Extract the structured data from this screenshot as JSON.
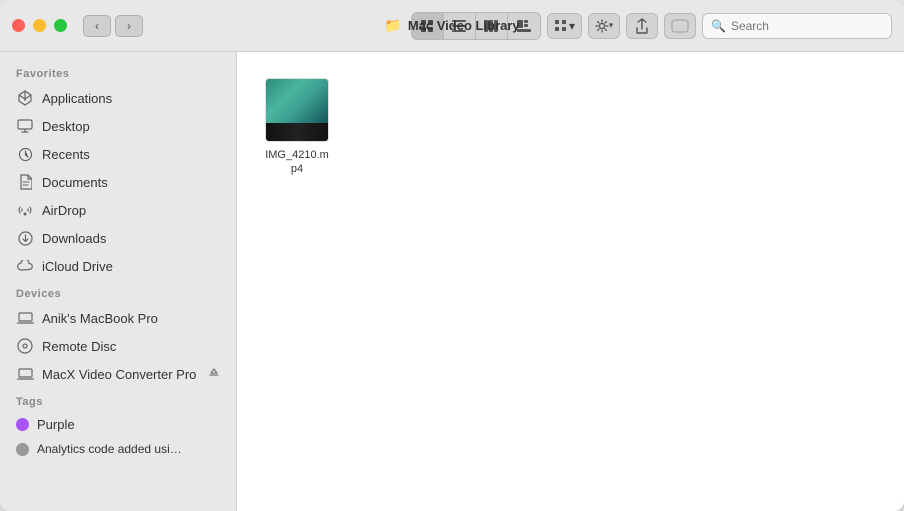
{
  "window": {
    "title": "Mac Video Library",
    "title_icon": "📁"
  },
  "toolbar": {
    "back_label": "‹",
    "forward_label": "›",
    "view_icon_grid": "⊞",
    "view_icon_list": "≡",
    "view_icon_column": "⊟",
    "view_icon_cover": "⊡",
    "view_dropdown_icon": "⊞",
    "settings_icon": "⚙",
    "share_icon": "↑",
    "tag_icon": "◻",
    "search_placeholder": "Search"
  },
  "sidebar": {
    "favorites_label": "Favorites",
    "devices_label": "Devices",
    "tags_label": "Tags",
    "favorites": [
      {
        "id": "applications",
        "label": "Applications",
        "icon": "🚀"
      },
      {
        "id": "desktop",
        "label": "Desktop",
        "icon": "🖥"
      },
      {
        "id": "recents",
        "label": "Recents",
        "icon": "🕐"
      },
      {
        "id": "documents",
        "label": "Documents",
        "icon": "📄"
      },
      {
        "id": "airdrop",
        "label": "AirDrop",
        "icon": "📡"
      },
      {
        "id": "downloads",
        "label": "Downloads",
        "icon": "⬇"
      },
      {
        "id": "icloud",
        "label": "iCloud Drive",
        "icon": "☁"
      }
    ],
    "devices": [
      {
        "id": "macbook",
        "label": "Anik's MacBook Pro",
        "icon": "💻",
        "eject": false
      },
      {
        "id": "remote-disc",
        "label": "Remote Disc",
        "icon": "💿",
        "eject": false
      },
      {
        "id": "macx",
        "label": "MacX Video Converter Pro",
        "icon": "💻",
        "eject": true
      }
    ],
    "tags": [
      {
        "id": "purple",
        "label": "Purple",
        "color": "#a855f7"
      },
      {
        "id": "analytics",
        "label": "Analytics code added using php",
        "color": "#aaa"
      }
    ]
  },
  "files": [
    {
      "id": "video1",
      "name": "IMG_4210.mp4",
      "type": "video"
    }
  ]
}
